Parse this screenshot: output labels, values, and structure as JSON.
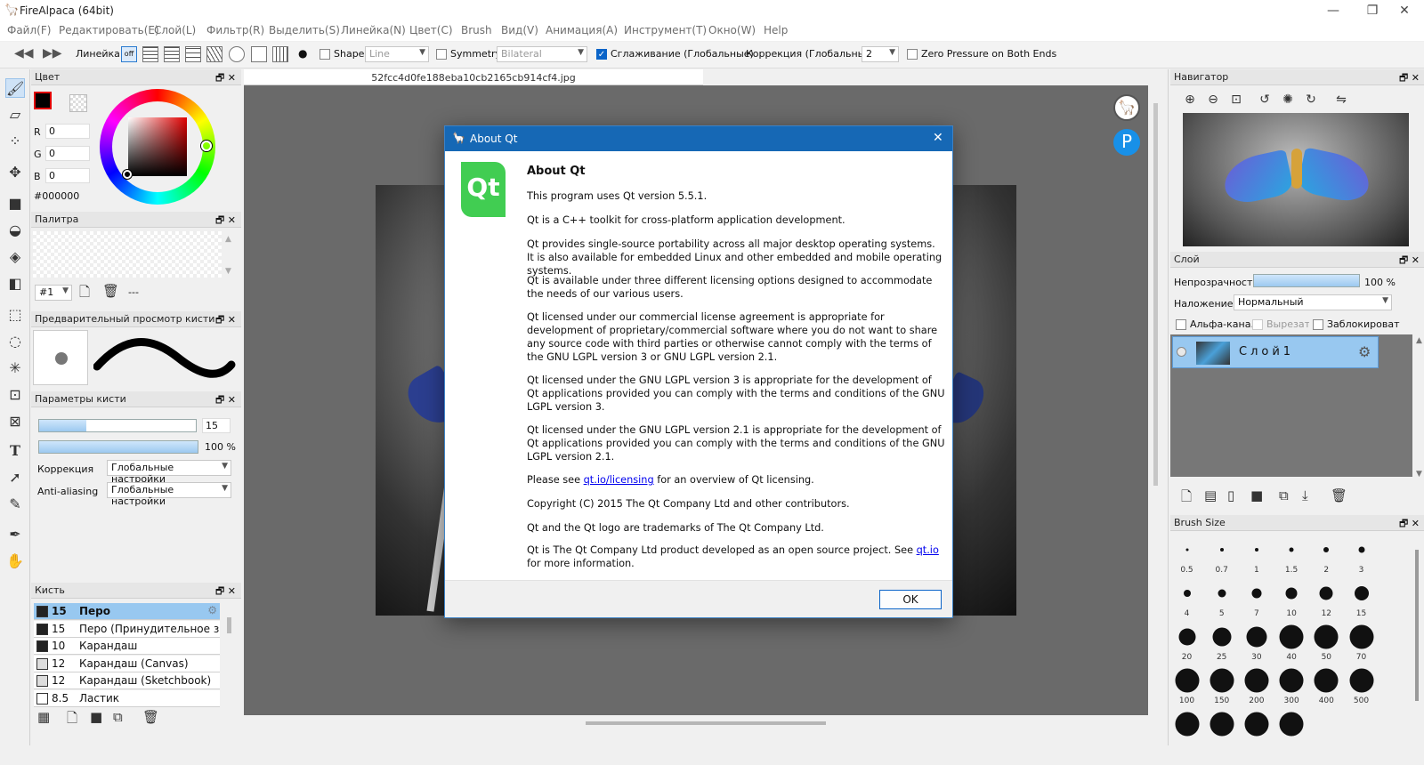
{
  "window": {
    "title": "FireAlpaca (64bit)",
    "minimize": "—",
    "maximize": "❐",
    "close": "✕"
  },
  "menu": [
    "Файл(F)",
    "Редактировать(E)",
    "Слой(L)",
    "Фильтр(R)",
    "Выделить(S)",
    "Линейка(N)",
    "Цвет(C)",
    "Brush",
    "Вид(V)",
    "Анимация(A)",
    "Инструмент(T)",
    "Окно(W)",
    "Help"
  ],
  "toolbar": {
    "ruler_label": "Линейка",
    "ruler_off": "off",
    "shape_label": "Shape",
    "shape_value": "Line",
    "symmetry_label": "Symmetry",
    "symmetry_value": "Bilateral",
    "smoothing_label": "Сглаживание (Глобальные)",
    "correction_label": "Коррекция (Глобальные)",
    "correction_value": "2",
    "zero_pressure_label": "Zero Pressure on Both Ends"
  },
  "color_panel": {
    "title": "Цвет",
    "r_label": "R",
    "r": "0",
    "g_label": "G",
    "g": "0",
    "b_label": "B",
    "b": "0",
    "hex": "#000000",
    "accent": "#000000"
  },
  "palette_panel": {
    "title": "Палитра",
    "index": "#1",
    "dash": "---"
  },
  "brush_preview_panel": {
    "title": "Предварительный просмотр кисти"
  },
  "brush_params": {
    "title": "Параметры кисти",
    "size": "15",
    "size_fill": 0.3,
    "opacity": "100 %",
    "opacity_fill": 1.0,
    "correction_label": "Коррекция",
    "correction_value": "Глобальные настройки",
    "aa_label": "Anti-aliasing",
    "aa_value": "Глобальные настройки"
  },
  "brush_panel": {
    "title": "Кисть",
    "items": [
      {
        "size": "15",
        "name": "Перо",
        "selected": true,
        "swatch": "#222"
      },
      {
        "size": "15",
        "name": "Перо (Принудительное затухание)",
        "selected": false,
        "swatch": "#222"
      },
      {
        "size": "10",
        "name": "Карандаш",
        "selected": false,
        "swatch": "#222"
      },
      {
        "size": "12",
        "name": "Карандаш (Canvas)",
        "selected": false,
        "swatch": "#ddd"
      },
      {
        "size": "12",
        "name": "Карандаш (Sketchbook)",
        "selected": false,
        "swatch": "#ddd"
      },
      {
        "size": "8.5",
        "name": "Ластик",
        "selected": false,
        "swatch": "#fff"
      }
    ]
  },
  "document": {
    "tab": "52fcc4d0fe188eba10cb2165cb914cf4.jpg"
  },
  "dialog": {
    "title": "About Qt",
    "heading": "About Qt",
    "logo": "Qt",
    "p1": "This program uses Qt version 5.5.1.",
    "p2": "Qt is a C++ toolkit for cross-platform application development.",
    "p3": "Qt provides single-source portability across all major desktop operating systems. It is also available for embedded Linux and other embedded and mobile operating systems.",
    "p4": "Qt is available under three different licensing options designed to accommodate the needs of our various users.",
    "p5": "Qt licensed under our commercial license agreement is appropriate for development of proprietary/commercial software where you do not want to share any source code with third parties or otherwise cannot comply with the terms of the GNU LGPL version 3 or GNU LGPL version 2.1.",
    "p6": "Qt licensed under the GNU LGPL version 3 is appropriate for the development of Qt applications provided you can comply with the terms and conditions of the GNU LGPL version 3.",
    "p7": "Qt licensed under the GNU LGPL version 2.1 is appropriate for the development of Qt applications provided you can comply with the terms and conditions of the GNU LGPL version 2.1.",
    "p8_pre": "Please see ",
    "p8_link": "qt.io/licensing",
    "p8_post": " for an overview of Qt licensing.",
    "p9": "Copyright (C) 2015 The Qt Company Ltd and other contributors.",
    "p10": "Qt and the Qt logo are trademarks of The Qt Company Ltd.",
    "p11_pre": "Qt is The Qt Company Ltd product developed as an open source project. See ",
    "p11_link": "qt.io",
    "p11_post": " for more information.",
    "ok": "OK",
    "close": "✕"
  },
  "navigator": {
    "title": "Навигатор"
  },
  "layer_panel": {
    "title": "Слой",
    "opacity_label": "Непрозрачность",
    "opacity": "100 %",
    "opacity_fill": 1.0,
    "blend_label": "Наложение",
    "blend_value": "Нормальный",
    "alpha_label": "Альфа-кана.",
    "clip_label": "Вырезать",
    "lock_label": "Заблокировать",
    "layer_name": "Слой1"
  },
  "brush_size": {
    "title": "Brush Size",
    "sizes": [
      "0.5",
      "0.7",
      "1",
      "1.5",
      "2",
      "3",
      "4",
      "5",
      "7",
      "10",
      "12",
      "15",
      "20",
      "25",
      "30",
      "40",
      "50",
      "70",
      "100",
      "150",
      "200",
      "300",
      "400",
      "500"
    ]
  }
}
